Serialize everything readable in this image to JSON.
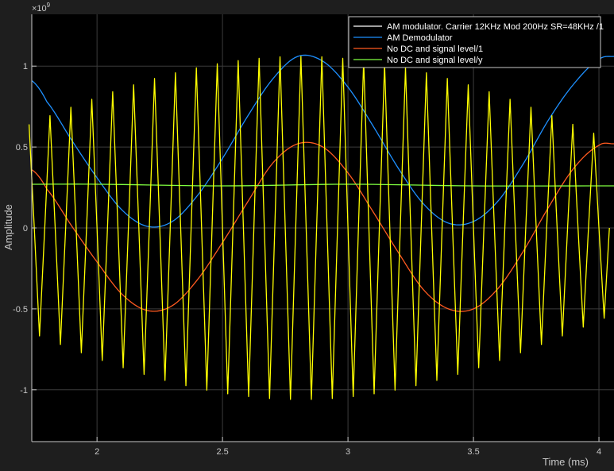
{
  "chart_data": {
    "type": "line",
    "xlabel": "Time (ms)",
    "ylabel": "Amplitude",
    "exponent_label": "×10",
    "exponent_power": "9",
    "xlim": [
      1.74,
      4.06
    ],
    "ylim": [
      -1.32,
      1.32
    ],
    "x_ticks": [
      2,
      2.5,
      3,
      3.5,
      4
    ],
    "x_tick_labels": [
      "2",
      "2.5",
      "3",
      "3.5",
      "4"
    ],
    "y_ticks": [
      -1,
      -0.5,
      0,
      0.5,
      1
    ],
    "y_tick_labels": [
      "-1",
      "-0.5",
      "0",
      "0.5",
      "1"
    ],
    "grid": true,
    "legend_location": "top-right",
    "background": "#000000",
    "series": [
      {
        "name": "AM modulator. Carrier 12KHz Mod 200Hz SR=48KHz /1",
        "color": "#ffff00",
        "carrier_khz": 12,
        "mod_hz": 200,
        "sample_rate_khz": 48,
        "sample_spacing_ms": 0.0208333,
        "peak": 1.06,
        "peak_time_ms": 2.8125
      },
      {
        "name": "AM Demodulator",
        "color": "#1e90ff",
        "x": [
          1.74,
          1.8,
          1.9,
          2.0,
          2.1,
          2.2,
          2.3,
          2.4,
          2.5,
          2.6,
          2.7,
          2.8,
          2.9,
          3.0,
          3.1,
          3.2,
          3.3,
          3.4,
          3.5,
          3.6,
          3.7,
          3.8,
          3.9,
          4.0,
          4.06
        ],
        "y": [
          0.91,
          0.78,
          0.54,
          0.31,
          0.11,
          0.01,
          0.04,
          0.2,
          0.43,
          0.69,
          0.92,
          1.06,
          1.03,
          0.87,
          0.63,
          0.37,
          0.15,
          0.03,
          0.04,
          0.17,
          0.4,
          0.67,
          0.89,
          1.04,
          1.06
        ]
      },
      {
        "name": "No DC and signal level/1",
        "color": "#ff5a20",
        "x": [
          1.74,
          1.8,
          1.9,
          2.0,
          2.1,
          2.2,
          2.3,
          2.4,
          2.5,
          2.6,
          2.7,
          2.8,
          2.9,
          3.0,
          3.1,
          3.2,
          3.3,
          3.4,
          3.5,
          3.6,
          3.7,
          3.8,
          3.9,
          4.0,
          4.06
        ],
        "y": [
          0.36,
          0.24,
          0.01,
          -0.21,
          -0.41,
          -0.51,
          -0.48,
          -0.32,
          -0.09,
          0.16,
          0.4,
          0.52,
          0.5,
          0.34,
          0.1,
          -0.15,
          -0.38,
          -0.5,
          -0.5,
          -0.37,
          -0.14,
          0.13,
          0.37,
          0.51,
          0.52
        ]
      },
      {
        "name": "No DC and signal level/y",
        "color": "#80ff40",
        "x": [
          1.74,
          2.0,
          2.5,
          3.0,
          3.5,
          4.0,
          4.06
        ],
        "y": [
          0.27,
          0.27,
          0.26,
          0.27,
          0.26,
          0.26,
          0.26
        ]
      }
    ]
  }
}
